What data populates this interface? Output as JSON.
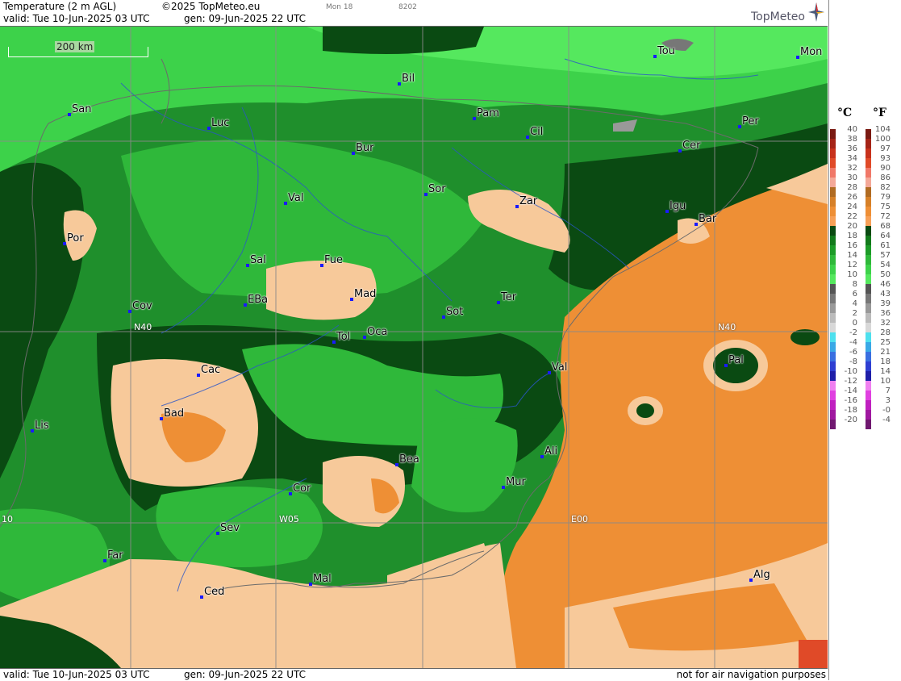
{
  "header": {
    "product": "Temperature (2 m AGL)",
    "copyright": "©2025 TopMeteo.eu",
    "run_code": "Mon 18",
    "code": "8202",
    "valid": "valid:  Tue  10-Jun-2025  03 UTC",
    "gen": "gen:  09-Jun-2025 22 UTC",
    "brand": "TopMeteo"
  },
  "footer": {
    "valid": "valid:  Tue  10-Jun-2025  03 UTC",
    "gen": "gen:  09-Jun-2025 22 UTC",
    "notice": "not for air navigation purposes"
  },
  "map": {
    "scale": "200 km",
    "grid_labels": {
      "n40_left": "N40",
      "n40_right": "N40",
      "w05": "W05",
      "e00": "E00",
      "w10": "10"
    },
    "cities": {
      "tou": "Tou",
      "mon": "Mon",
      "bil": "Bil",
      "san": "San",
      "luc": "Luc",
      "pam": "Pam",
      "cil": "Cil",
      "per": "Per",
      "bur": "Bur",
      "cer": "Cer",
      "val_n": "Val",
      "sor": "Sor",
      "zar": "Zar",
      "igu": "Igu",
      "bar": "Bar",
      "por": "Por",
      "sal": "Sal",
      "fue": "Fue",
      "mad": "Mad",
      "ter": "Ter",
      "cov": "Cov",
      "eba": "EBa",
      "sot": "Sot",
      "tol": "Tol",
      "oca": "Oca",
      "cac": "Cac",
      "val_e": "Val",
      "pal": "Pal",
      "bad": "Bad",
      "lis": "Lis",
      "bea": "Bea",
      "ali": "Ali",
      "mur": "Mur",
      "cor": "Cor",
      "sev": "Sev",
      "far": "Far",
      "mal": "Mal",
      "ced": "Ced",
      "alg": "Alg"
    }
  },
  "legend": {
    "celsius_head": "°C",
    "fahrenheit_head": "°F",
    "celsius": [
      "40",
      "38",
      "36",
      "34",
      "32",
      "30",
      "28",
      "26",
      "24",
      "22",
      "20",
      "18",
      "16",
      "14",
      "12",
      "10",
      "8",
      "6",
      "4",
      "2",
      "0",
      "-2",
      "-4",
      "-6",
      "-8",
      "-10",
      "-12",
      "-14",
      "-16",
      "-18",
      "-20"
    ],
    "fahrenheit": [
      "104",
      "100",
      "97",
      "93",
      "90",
      "86",
      "82",
      "79",
      "75",
      "72",
      "68",
      "64",
      "61",
      "57",
      "54",
      "50",
      "46",
      "43",
      "39",
      "36",
      "32",
      "28",
      "25",
      "21",
      "18",
      "14",
      "10",
      "7",
      "3",
      "-0",
      "-4"
    ],
    "colors": [
      "#7a1a12",
      "#a52417",
      "#c8321c",
      "#e04a28",
      "#f07868",
      "#f4a898",
      "#b06b22",
      "#d68028",
      "#ee8f35",
      "#f7a057",
      "#0a4a12",
      "#137a1c",
      "#1d9b28",
      "#2fb83a",
      "#3dd24a",
      "#55e85e",
      "#555555",
      "#777777",
      "#999999",
      "#bbbbbb",
      "#d8d8d8",
      "#4ee0ee",
      "#3aa8e6",
      "#3a6fe0",
      "#2f3fd2",
      "#1f1fa8",
      "#f080f0",
      "#e040e0",
      "#c020c0",
      "#a018a0",
      "#701870"
    ]
  }
}
